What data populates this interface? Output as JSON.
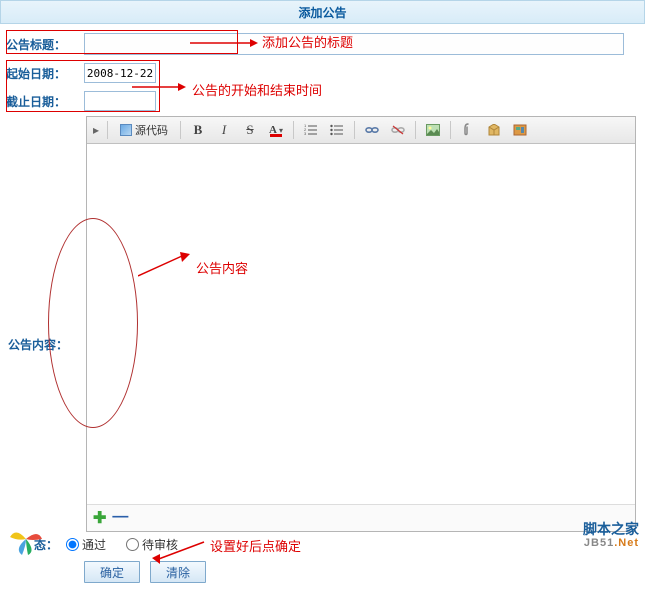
{
  "header": {
    "title": "添加公告"
  },
  "form": {
    "title_label": "公告标题：",
    "title_value": "",
    "start_date_label": "起始日期：",
    "start_date_value": "2008-12-22",
    "end_date_label": "截止日期：",
    "end_date_value": "",
    "content_label": "公告内容：",
    "status_label": "态：",
    "status_options": {
      "pass": "通过",
      "pending": "待审核"
    }
  },
  "editor": {
    "source_btn": "源代码",
    "bold": "B",
    "italic": "I",
    "strike": "S",
    "textcolor": "A"
  },
  "buttons": {
    "ok": "确定",
    "clear": "清除"
  },
  "annotations": {
    "a1": "添加公告的标题",
    "a2": "公告的开始和结束时间",
    "a3": "公告内容",
    "a4": "设置好后点确定"
  },
  "watermark": {
    "cn": "脚本之家",
    "en": "JB51",
    "suffix": ".Net"
  }
}
